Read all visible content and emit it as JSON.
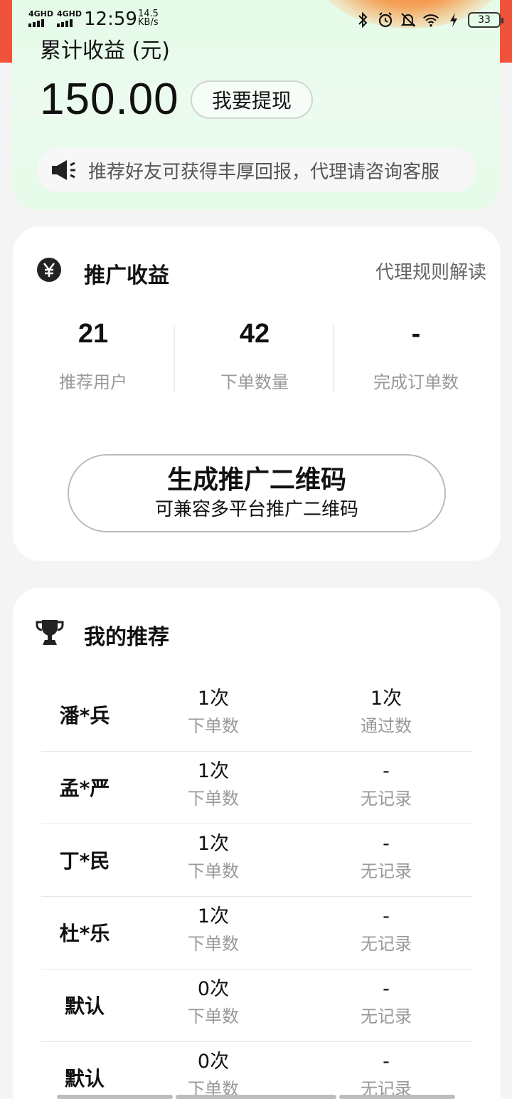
{
  "status_bar": {
    "signal1": "4GHD",
    "signal2": "4GHD",
    "time": "12:59",
    "speed_value": "14.5",
    "speed_unit": "KB/s",
    "battery": "33"
  },
  "earnings": {
    "label": "累计收益 (元)",
    "amount": "150.00",
    "withdraw_label": "我要提现",
    "notice": "推荐好友可获得丰厚回报，代理请咨询客服"
  },
  "promotion": {
    "title": "推广收益",
    "rules_link": "代理规则解读",
    "stats": [
      {
        "value": "21",
        "label": "推荐用户"
      },
      {
        "value": "42",
        "label": "下单数量"
      },
      {
        "value": "-",
        "label": "完成订单数"
      }
    ],
    "qr_button": {
      "main": "生成推广二维码",
      "sub": "可兼容多平台推广二维码"
    }
  },
  "recommendations": {
    "title": "我的推荐",
    "rows": [
      {
        "name": "潘*兵",
        "orders": "1次",
        "orders_label": "下单数",
        "result": "1次",
        "result_label": "通过数"
      },
      {
        "name": "孟*严",
        "orders": "1次",
        "orders_label": "下单数",
        "result": "-",
        "result_label": "无记录"
      },
      {
        "name": "丁*民",
        "orders": "1次",
        "orders_label": "下单数",
        "result": "-",
        "result_label": "无记录"
      },
      {
        "name": "杜*乐",
        "orders": "1次",
        "orders_label": "下单数",
        "result": "-",
        "result_label": "无记录"
      },
      {
        "name": "默认",
        "orders": "0次",
        "orders_label": "下单数",
        "result": "-",
        "result_label": "无记录"
      },
      {
        "name": "默认",
        "orders": "0次",
        "orders_label": "下单数",
        "result": "-",
        "result_label": "无记录"
      }
    ]
  },
  "colors": {
    "accent_red": "#f1533a",
    "card_green": "#e2fbe6",
    "muted_text": "#999999"
  }
}
